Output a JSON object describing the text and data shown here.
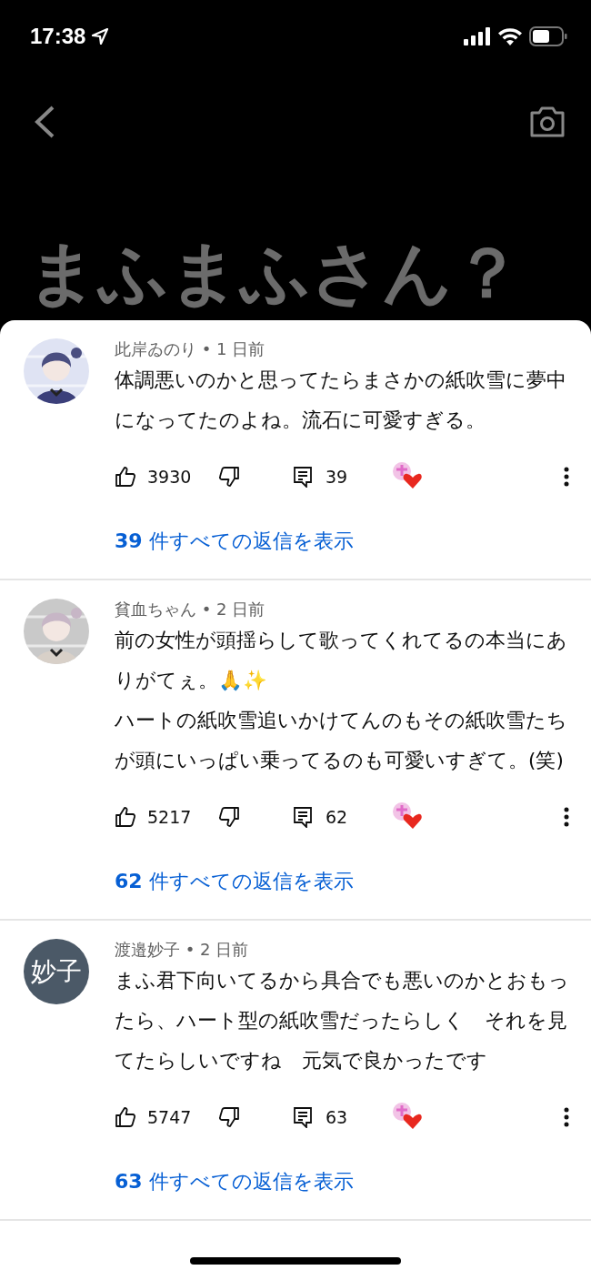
{
  "status_bar": {
    "time": "17:38"
  },
  "header": {
    "background_title": "まふまふさん？"
  },
  "comments": [
    {
      "meta": "此岸ゐのり • 1 日前",
      "text": "体調悪いのかと思ってたらまさかの紙吹雪に夢中になってたのよね。流石に可愛すぎる。",
      "likes": "3930",
      "replies": "39",
      "creator_hearted": true,
      "reply_link": "**39** 件すべての返信を表示"
    },
    {
      "meta": "貧血ちゃん • 2 日前",
      "text": "前の女性が頭揺らして歌ってくれてるの本当にありがてぇ。🙏✨\nハートの紙吹雪追いかけてんのもその紙吹雪たちが頭にいっぱい乗ってるのも可愛いすぎて。(笑)",
      "likes": "5217",
      "replies": "62",
      "creator_hearted": true,
      "reply_link": "**62** 件すべての返信を表示"
    },
    {
      "avatar": {
        "kind": "initials",
        "text": "妙子"
      },
      "meta": "渡邉妙子 • 2 日前",
      "text": "まふ君下向いてるから具合でも悪いのかとおもったら、ハート型の紙吹雪だったらしく　それを見てたらしいですね　元気で良かったです",
      "likes": "5747",
      "replies": "63",
      "creator_hearted": true,
      "reply_link": "**63** 件すべての返信を表示"
    }
  ]
}
